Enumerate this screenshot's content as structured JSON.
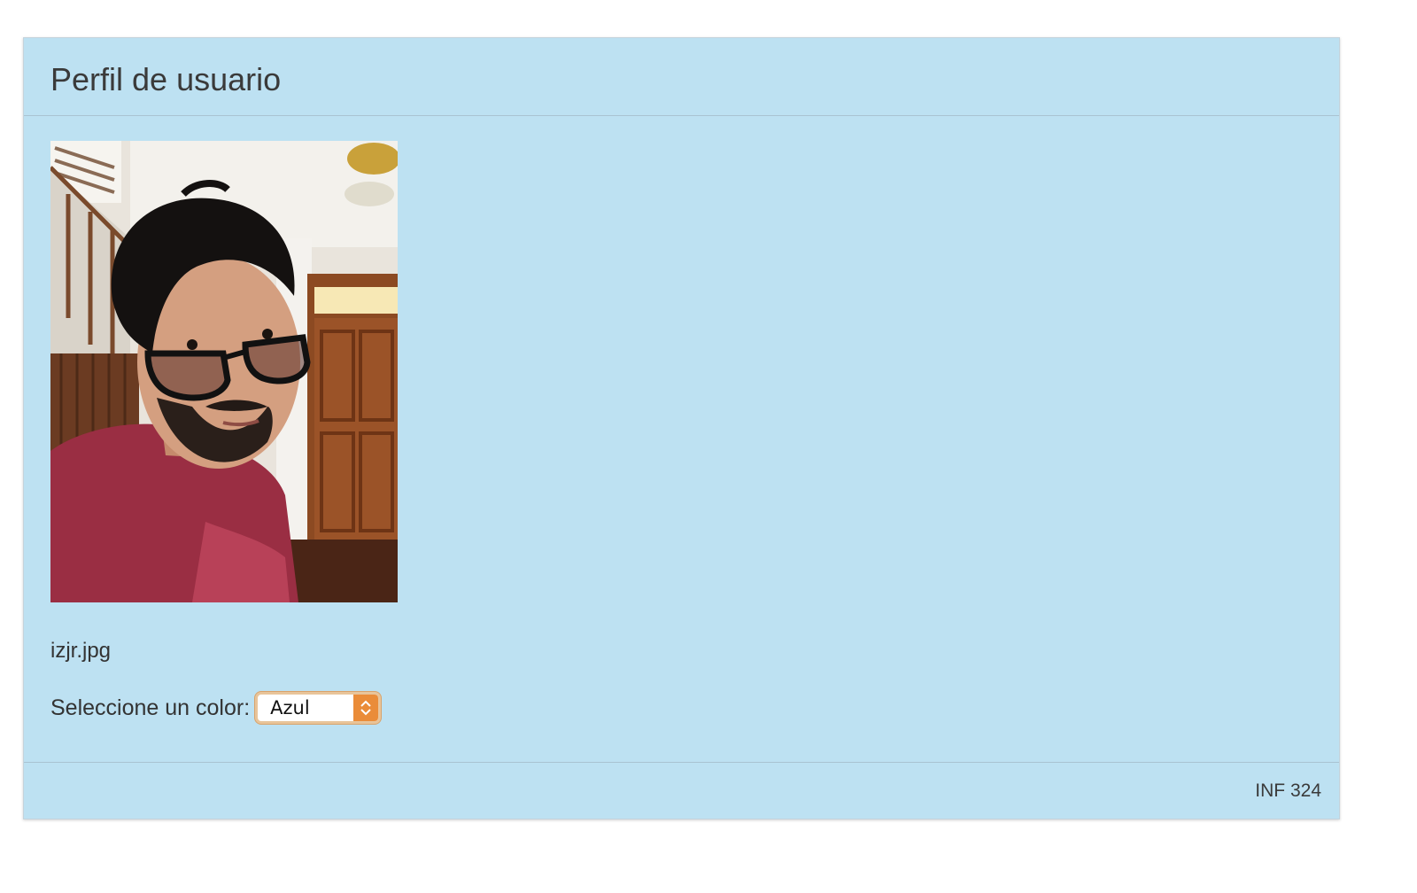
{
  "header": {
    "title": "Perfil de usuario"
  },
  "profile": {
    "photo_name": "user-photo",
    "filename": "izjr.jpg"
  },
  "color_select": {
    "label": "Seleccione un color:",
    "selected": "Azul"
  },
  "footer": {
    "text": "INF 324"
  },
  "colors": {
    "panel_bg": "#bde1f2",
    "select_accent": "#ea8c39"
  }
}
